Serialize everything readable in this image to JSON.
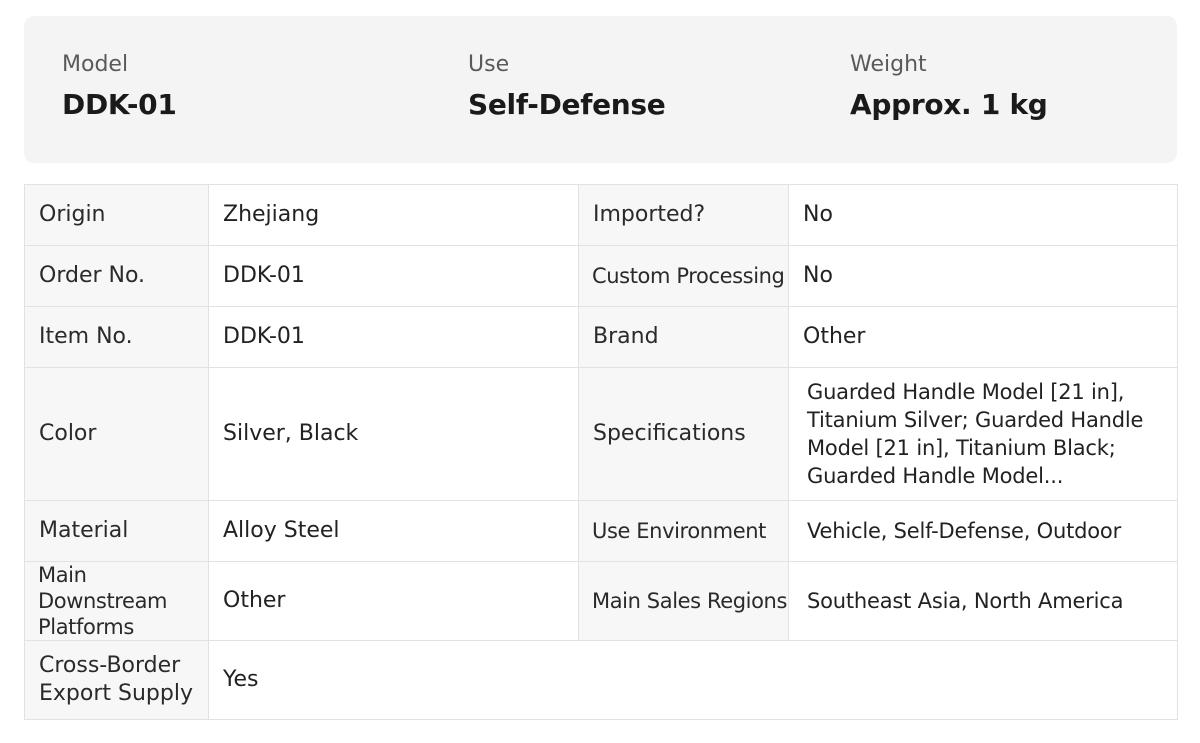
{
  "summary": {
    "model": {
      "label": "Model",
      "value": "DDK-01"
    },
    "use": {
      "label": "Use",
      "value": "Self-Defense"
    },
    "weight": {
      "label": "Weight",
      "value": "Approx. 1 kg"
    }
  },
  "attributes": {
    "origin": {
      "label": "Origin",
      "value": "Zhejiang"
    },
    "imported": {
      "label": "Imported?",
      "value": "No"
    },
    "order_no": {
      "label": "Order No.",
      "value": "DDK-01"
    },
    "custom_processing": {
      "label": "Custom Processing",
      "value": "No"
    },
    "item_no": {
      "label": "Item No.",
      "value": "DDK-01"
    },
    "brand": {
      "label": "Brand",
      "value": "Other"
    },
    "color": {
      "label": "Color",
      "value": "Silver, Black"
    },
    "specifications": {
      "label": "Specifications",
      "value": "Guarded Handle Model [21 in], Titanium Silver; Guarded Handle Model [21 in], Titanium Black; Guarded Handle Model..."
    },
    "material": {
      "label": "Material",
      "value": "Alloy Steel"
    },
    "use_environment": {
      "label": "Use Environment",
      "value": "Vehicle, Self-Defense, Outdoor"
    },
    "downstream_platforms": {
      "label": "Main Downstream Platforms",
      "value": "Other"
    },
    "sales_regions": {
      "label": "Main Sales Regions",
      "value": "Southeast Asia, North America"
    },
    "cross_border": {
      "label": "Cross-Border Export Supply",
      "value": "Yes"
    }
  }
}
